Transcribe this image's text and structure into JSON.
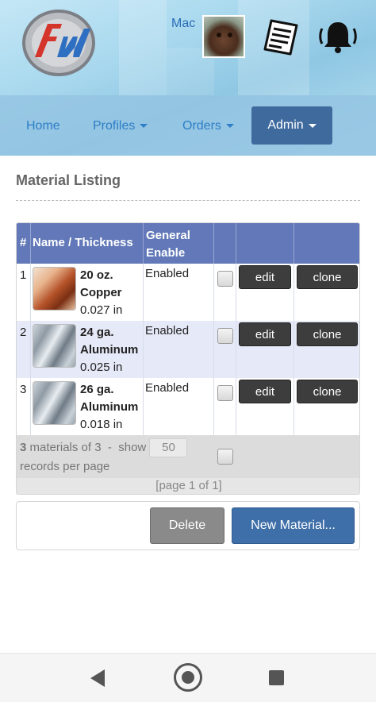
{
  "header": {
    "user_name": "Mac",
    "logo_icon": "fw-logo-icon",
    "avatar_icon": "dog-avatar",
    "document_icon": "document-icon",
    "bell_icon": "bell-icon"
  },
  "nav": {
    "home": "Home",
    "profiles": "Profiles",
    "orders": "Orders",
    "admin": "Admin"
  },
  "page": {
    "title": "Material Listing"
  },
  "table": {
    "headers": {
      "num": "#",
      "name": "Name / Thickness",
      "enable_line1": "General",
      "enable_line2": "Enable"
    },
    "rows": [
      {
        "num": "1",
        "name_line1": "20 oz.",
        "name_line2": "Copper",
        "thickness": "0.027 in",
        "enable": "Enabled",
        "edit": "edit",
        "clone": "clone"
      },
      {
        "num": "2",
        "name_line1": "24 ga.",
        "name_line2": "Aluminum",
        "thickness": "0.025 in",
        "enable": "Enabled",
        "edit": "edit",
        "clone": "clone"
      },
      {
        "num": "3",
        "name_line1": "26 ga.",
        "name_line2": "Aluminum",
        "thickness": "0.018 in",
        "enable": "Enabled",
        "edit": "edit",
        "clone": "clone"
      }
    ],
    "footer": {
      "count": "3",
      "count_text": "materials of 3",
      "sep": "-",
      "show": "show",
      "per_page_value": "50",
      "records_per_page": "records per page",
      "pager": "[page 1 of 1]"
    }
  },
  "actions": {
    "delete": "Delete",
    "new_material": "New Material..."
  },
  "colors": {
    "header_bar": "#6278b8",
    "alt_row": "#e6e9f7",
    "primary": "#3f6fa8",
    "admin": "#3e6a9e"
  }
}
